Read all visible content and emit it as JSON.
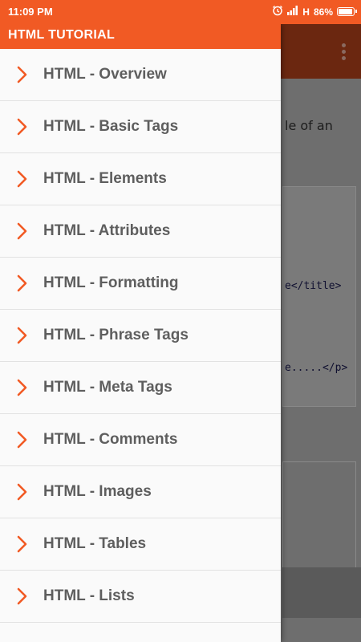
{
  "status_bar": {
    "time": "11:09 PM",
    "network": "H",
    "battery": "86%",
    "battery_level": 0.86,
    "icons": [
      "alarm-icon",
      "signal-icon",
      "battery-icon"
    ]
  },
  "drawer": {
    "title": "HTML TUTORIAL",
    "items": [
      {
        "label": "HTML - Overview"
      },
      {
        "label": "HTML - Basic Tags"
      },
      {
        "label": "HTML - Elements"
      },
      {
        "label": "HTML - Attributes"
      },
      {
        "label": "HTML - Formatting"
      },
      {
        "label": "HTML - Phrase Tags"
      },
      {
        "label": "HTML - Meta Tags"
      },
      {
        "label": "HTML - Comments"
      },
      {
        "label": "HTML - Images"
      },
      {
        "label": "HTML - Tables"
      },
      {
        "label": "HTML - Lists"
      }
    ]
  },
  "background": {
    "text_fragment": "le of an",
    "code_lines": [
      "e</title>",
      "e.....</p>"
    ]
  },
  "colors": {
    "accent": "#f15a24",
    "toolbar_dimmed": "#6b2710",
    "item_text": "#5e5e5e"
  }
}
